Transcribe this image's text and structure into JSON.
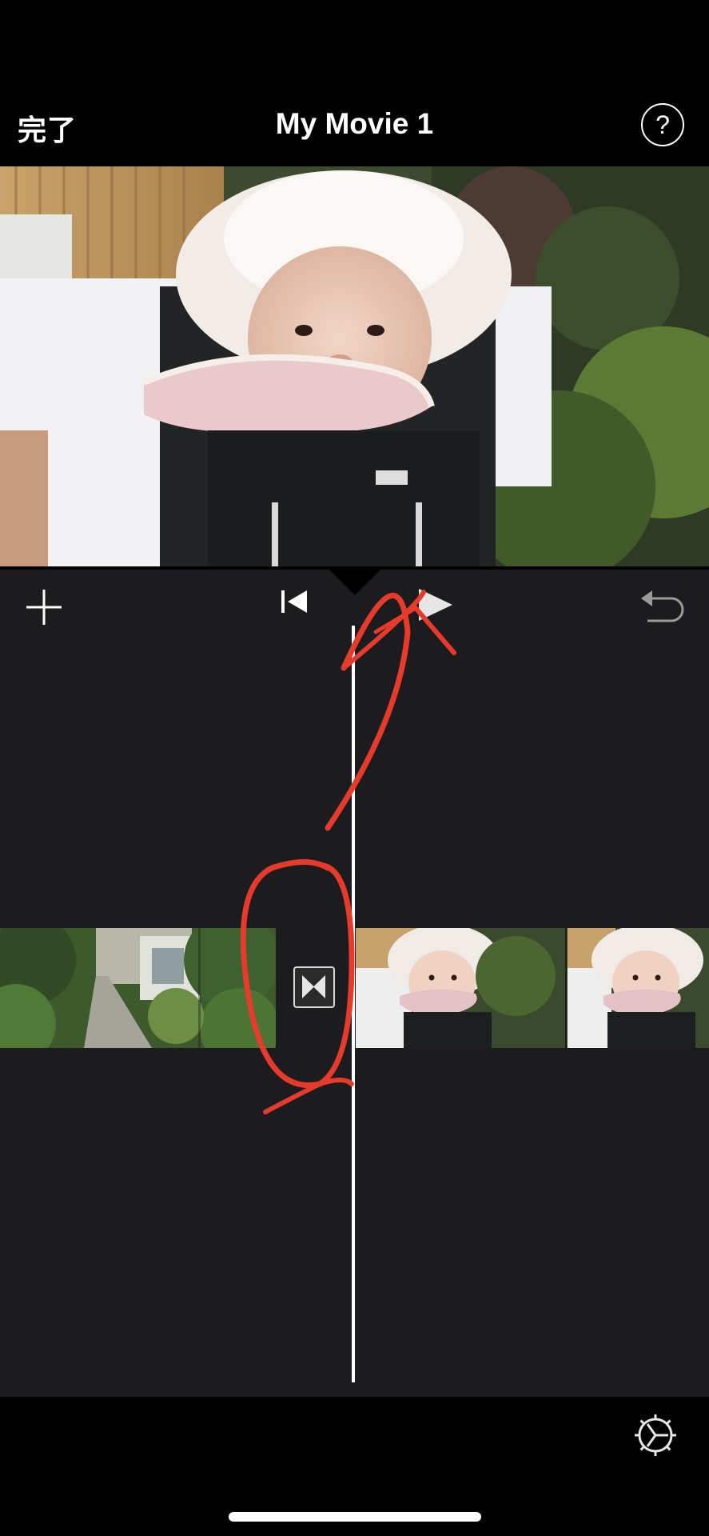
{
  "header": {
    "done_label": "完了",
    "title": "My Movie 1",
    "help_label": "?"
  },
  "toolbar": {
    "add_icon": "plus-icon",
    "skip_icon": "skip-to-start-icon",
    "play_icon": "play-icon",
    "undo_icon": "undo-icon"
  },
  "timeline": {
    "clips": [
      {
        "name": "clip-garden-path",
        "thumbnails": 1
      },
      {
        "name": "clip-baby",
        "thumbnails": 2
      }
    ],
    "transition_icon": "transition-icon"
  },
  "footer": {
    "settings_icon": "gear-icon"
  },
  "colors": {
    "background": "#000000",
    "timeline_bg": "#1c1c1e",
    "annotation": "#e53a2c",
    "playhead": "#ffffff"
  }
}
